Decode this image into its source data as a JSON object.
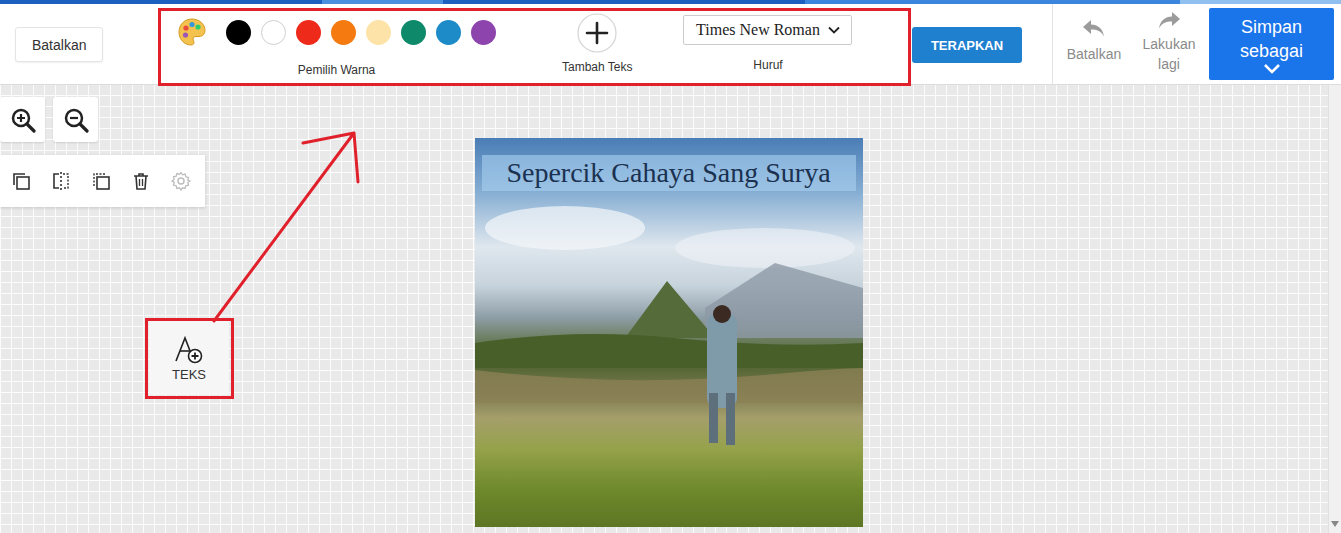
{
  "header": {
    "cancel_button": "Batalkan",
    "colors": [
      {
        "color": "#000000"
      },
      {
        "color": "#ffffff"
      },
      {
        "color": "#ee2a1b"
      },
      {
        "color": "#f57a10"
      },
      {
        "color": "#fde3a7"
      },
      {
        "color": "#0e8a6b"
      },
      {
        "color": "#1e8bc9"
      },
      {
        "color": "#8e44ad"
      }
    ],
    "color_picker_label": "Pemilih Warna",
    "add_text_label": "Tambah Teks",
    "font": {
      "value": "Times New Roman",
      "label": "Huruf"
    },
    "apply_button": "TERAPKAN",
    "undo": {
      "label": "Batalkan",
      "disabled": true
    },
    "redo": {
      "label": "Lakukan lagi",
      "disabled": true
    },
    "save_button": "Simpan sebagai"
  },
  "object_tools": [
    {
      "kind": "copy",
      "disabled": false
    },
    {
      "kind": "flip",
      "disabled": false
    },
    {
      "kind": "duplicate",
      "disabled": false
    },
    {
      "kind": "delete",
      "disabled": false
    },
    {
      "kind": "settings",
      "disabled": true
    }
  ],
  "text_tool": {
    "label": "TEKS"
  },
  "canvas_text": {
    "text": "Sepercik Cahaya Sang Surya",
    "selected": true
  }
}
